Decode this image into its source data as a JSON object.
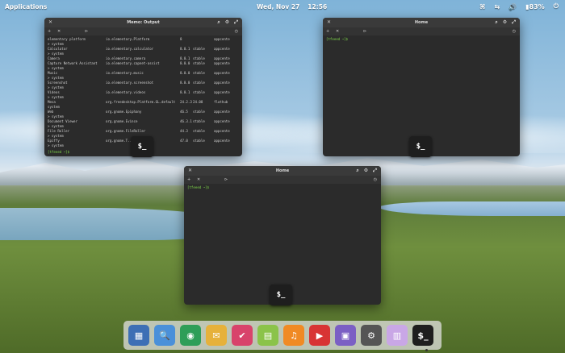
{
  "topbar": {
    "applications": "Applications",
    "date": "Wed, Nov 27",
    "time": "12:56",
    "battery": "83%"
  },
  "win1": {
    "title": "Memo: Output",
    "prompt": "[tfeeed ~]$",
    "rows": [
      [
        "elementary platform",
        "io.elementary.Platform",
        "8",
        "",
        "appcente"
      ],
      [
        "> system",
        "",
        "",
        "",
        ""
      ],
      [
        "Calculator",
        "io.elementary.calculator",
        "8.0.1",
        "stable",
        "appcente"
      ],
      [
        "> system",
        "",
        "",
        "",
        ""
      ],
      [
        "Camera",
        "io.elementary.camera",
        "8.0.1",
        "stable",
        "appcente"
      ],
      [
        "Capture Network Assistant",
        "io.elementary.capnet-assist",
        "8.0.0",
        "stable",
        "appcente"
      ],
      [
        "> system",
        "",
        "",
        "",
        ""
      ],
      [
        "Music",
        "io.elementary.music",
        "8.0.0",
        "stable",
        "appcente"
      ],
      [
        "> system",
        "",
        "",
        "",
        ""
      ],
      [
        "Screenshot",
        "io.elementary.screenshot",
        "8.0.0",
        "stable",
        "appcente"
      ],
      [
        "> system",
        "",
        "",
        "",
        ""
      ],
      [
        "Videos",
        "io.elementary.videos",
        "8.0.1",
        "stable",
        "appcente"
      ],
      [
        "> system",
        "",
        "",
        "",
        ""
      ],
      [
        "Mesa",
        "org.freedesktop.Platform.GL.default",
        "24.2.3",
        "24.08",
        "flathub"
      ],
      [
        "  system",
        "",
        "",
        "",
        ""
      ],
      [
        "Web",
        "org.gnome.Epiphany",
        "46.5",
        "stable",
        "appcente"
      ],
      [
        "> system",
        "",
        "",
        "",
        ""
      ],
      [
        "Document Viewer",
        "org.gnome.Evince",
        "46.3.1",
        "stable",
        "appcente"
      ],
      [
        "> system",
        "",
        "",
        "",
        ""
      ],
      [
        "File Roller",
        "org.gnome.FileRoller",
        "44.3",
        "stable",
        "appcente"
      ],
      [
        "> system",
        "",
        "",
        "",
        ""
      ],
      [
        "Epiffy",
        "org.gnome.T...",
        "47.0",
        "stable",
        "appcente"
      ],
      [
        "> system",
        "",
        "",
        "",
        ""
      ]
    ]
  },
  "win2": {
    "title": "Home",
    "prompt": "[tfeeed ~]$"
  },
  "win3": {
    "title": "Home",
    "prompt": "[tfeeed ~]$"
  },
  "terminal_glyph": "$_",
  "dock": [
    {
      "name": "multitasking-view-icon",
      "glyph": "▦",
      "color": "#3d6fb5"
    },
    {
      "name": "files-icon",
      "glyph": "🔍",
      "color": "#4a90d9"
    },
    {
      "name": "web-browser-icon",
      "glyph": "◉",
      "color": "#2e9e58"
    },
    {
      "name": "mail-icon",
      "glyph": "✉",
      "color": "#e6b13b"
    },
    {
      "name": "tasks-icon",
      "glyph": "✔",
      "color": "#d8436b"
    },
    {
      "name": "calendar-icon",
      "glyph": "▤",
      "color": "#8bc34a"
    },
    {
      "name": "music-icon",
      "glyph": "♫",
      "color": "#f08a24"
    },
    {
      "name": "videos-icon",
      "glyph": "▶",
      "color": "#d83434"
    },
    {
      "name": "photos-icon",
      "glyph": "▣",
      "color": "#7b5fc4"
    },
    {
      "name": "settings-icon",
      "glyph": "⚙",
      "color": "#555555"
    },
    {
      "name": "appcenter-icon",
      "glyph": "▥",
      "color": "#c9a7e6"
    },
    {
      "name": "terminal-icon",
      "glyph": "$_",
      "color": "#1e1e1e"
    }
  ]
}
